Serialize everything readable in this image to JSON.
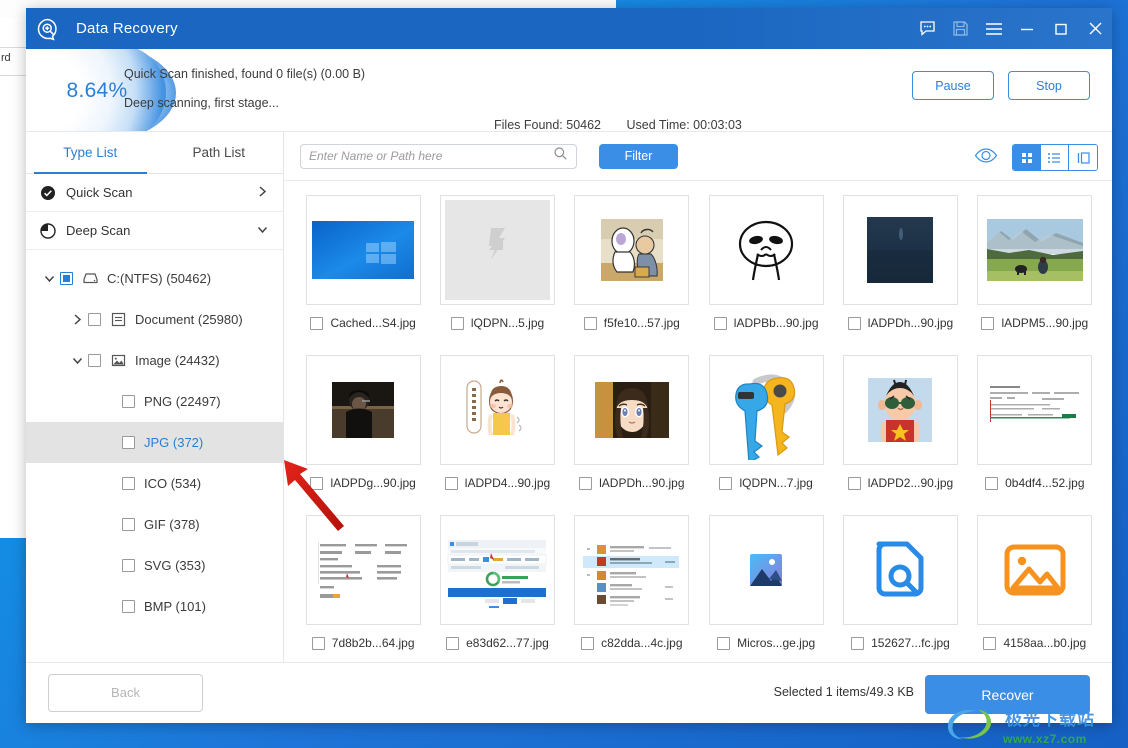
{
  "window": {
    "title": "Data Recovery",
    "icon": "app-magnifier-icon",
    "controls": {
      "feedback": "feedback-icon",
      "save": "save-icon",
      "menu": "hamburger-menu-icon",
      "minimize": "minimize-icon",
      "maximize": "maximize-icon",
      "close": "close-icon"
    }
  },
  "status": {
    "percent": "8.64%",
    "line1": "Quick Scan finished, found 0 file(s) (0.00  B)",
    "line2": "Deep scanning, first stage...",
    "files_found": "Files Found: 50462",
    "used_time": "Used Time: 00:03:03",
    "pause_label": "Pause",
    "stop_label": "Stop"
  },
  "sidebar": {
    "tabs": [
      {
        "label": "Type List",
        "active": true
      },
      {
        "label": "Path List",
        "active": false
      }
    ],
    "scan_rows": [
      {
        "label": "Quick Scan",
        "icon": "check-circle-icon",
        "chevron": "chevron-right-icon"
      },
      {
        "label": "Deep Scan",
        "icon": "pie-progress-icon",
        "chevron": "chevron-down-icon"
      }
    ],
    "tree": [
      {
        "label": "C:(NTFS) (50462)",
        "indent": 0,
        "twist": "chevron-down-icon",
        "checkbox": "partial",
        "icon": "drive-icon",
        "selected": false
      },
      {
        "label": "Document (25980)",
        "indent": 1,
        "twist": "chevron-right-icon",
        "checkbox": "empty",
        "icon": "document-icon",
        "selected": false
      },
      {
        "label": "Image (24432)",
        "indent": 1,
        "twist": "chevron-down-icon",
        "checkbox": "empty",
        "icon": "image-icon",
        "selected": false
      },
      {
        "label": "PNG (22497)",
        "indent": 2,
        "twist": "",
        "checkbox": "empty",
        "icon": "",
        "selected": false
      },
      {
        "label": "JPG (372)",
        "indent": 2,
        "twist": "",
        "checkbox": "empty",
        "icon": "",
        "selected": true
      },
      {
        "label": "ICO (534)",
        "indent": 2,
        "twist": "",
        "checkbox": "empty",
        "icon": "",
        "selected": false
      },
      {
        "label": "GIF (378)",
        "indent": 2,
        "twist": "",
        "checkbox": "empty",
        "icon": "",
        "selected": false
      },
      {
        "label": "SVG (353)",
        "indent": 2,
        "twist": "",
        "checkbox": "empty",
        "icon": "",
        "selected": false
      },
      {
        "label": "BMP (101)",
        "indent": 2,
        "twist": "",
        "checkbox": "empty",
        "icon": "",
        "selected": false
      }
    ]
  },
  "toolbar": {
    "search_placeholder": "Enter Name or Path here",
    "search_value": "",
    "search_icon": "search-icon",
    "filter_label": "Filter",
    "preview_icon": "eye-icon",
    "view_modes": [
      {
        "name": "grid-view",
        "active": true
      },
      {
        "name": "list-view",
        "active": false
      },
      {
        "name": "detail-view",
        "active": false
      }
    ]
  },
  "files": [
    {
      "name": "Cached...S4.jpg",
      "thumb": "windows-wallpaper",
      "checked": false
    },
    {
      "name": "lQDPN...5.jpg",
      "thumb": "placeholder-gray",
      "checked": false
    },
    {
      "name": "f5fe10...57.jpg",
      "thumb": "cartoon-cook",
      "checked": false
    },
    {
      "name": "lADPBb...90.jpg",
      "thumb": "meme-face",
      "checked": false
    },
    {
      "name": "lADPDh...90.jpg",
      "thumb": "dark-sea",
      "checked": false
    },
    {
      "name": "lADPM5...90.jpg",
      "thumb": "mountain-meadow",
      "checked": false
    },
    {
      "name": "lADPDg...90.jpg",
      "thumb": "dark-portrait",
      "checked": false
    },
    {
      "name": "lADPD4...90.jpg",
      "thumb": "cartoon-girl",
      "checked": false
    },
    {
      "name": "lADPDh...90.jpg",
      "thumb": "anime-face",
      "checked": false
    },
    {
      "name": "lQDPN...7.jpg",
      "thumb": "keys-clipart",
      "checked": false
    },
    {
      "name": "lADPD2...90.jpg",
      "thumb": "cartoon-boy",
      "checked": false
    },
    {
      "name": "0b4df4...52.jpg",
      "thumb": "text-doc-shot",
      "checked": false
    },
    {
      "name": "7d8b2b...64.jpg",
      "thumb": "text-screenshot",
      "checked": false
    },
    {
      "name": "e83d62...77.jpg",
      "thumb": "browser-screenshot",
      "checked": false
    },
    {
      "name": "c82dda...4c.jpg",
      "thumb": "list-screenshot",
      "checked": false
    },
    {
      "name": "Micros...ge.jpg",
      "thumb": "photos-app-icon",
      "checked": false
    },
    {
      "name": "152627...fc.jpg",
      "thumb": "file-search-icon",
      "checked": false
    },
    {
      "name": "4158aa...b0.jpg",
      "thumb": "orange-image-icon",
      "checked": false
    }
  ],
  "footer": {
    "back_label": "Back",
    "selection_info": "Selected 1 items/49.3 KB",
    "recover_label": "Recover"
  },
  "watermark": {
    "cn_text": "极光下载站",
    "url_text": "www.xz7.com"
  },
  "background": {
    "doc_text": "rd"
  },
  "colors": {
    "accent": "#3a8ee6",
    "titlebar": "#1a66c0",
    "link": "#2a7fd4",
    "selection": "#e3e3e3"
  }
}
